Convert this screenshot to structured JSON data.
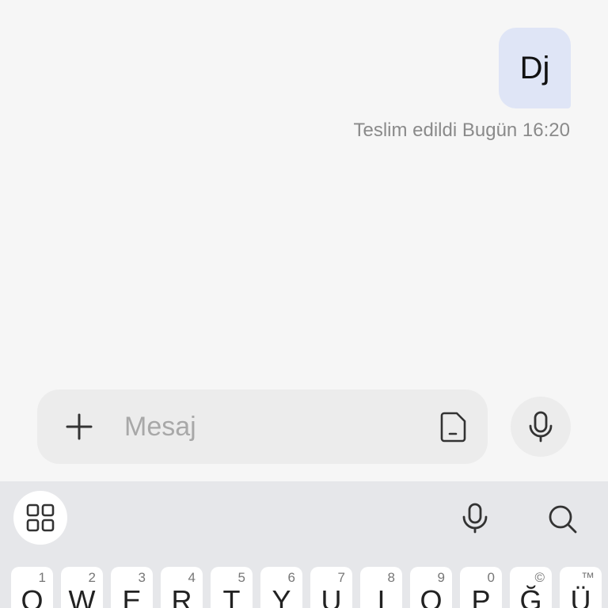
{
  "thread": {
    "message_text": "Dj",
    "status": "Teslim edildi Bugün 16:20"
  },
  "compose": {
    "placeholder": "Mesaj",
    "add_icon": "plus-icon",
    "sticker_icon": "sticker-icon",
    "voice_icon": "microphone-icon"
  },
  "keyboard": {
    "toolbar": {
      "apps_icon": "grid-icon",
      "mic_icon": "microphone-icon",
      "search_icon": "search-icon"
    },
    "row1": [
      {
        "letter": "Q",
        "hint": "1"
      },
      {
        "letter": "W",
        "hint": "2"
      },
      {
        "letter": "E",
        "hint": "3"
      },
      {
        "letter": "R",
        "hint": "4"
      },
      {
        "letter": "T",
        "hint": "5"
      },
      {
        "letter": "Y",
        "hint": "6"
      },
      {
        "letter": "U",
        "hint": "7"
      },
      {
        "letter": "I",
        "hint": "8"
      },
      {
        "letter": "O",
        "hint": "9"
      },
      {
        "letter": "P",
        "hint": "0"
      },
      {
        "letter": "Ğ",
        "hint": "©"
      },
      {
        "letter": "Ü",
        "hint": "™"
      }
    ]
  },
  "colors": {
    "background": "#f6f6f6",
    "bubble": "#dfe5f6",
    "compose": "#ececec",
    "keyboard": "#e6e7ea"
  }
}
